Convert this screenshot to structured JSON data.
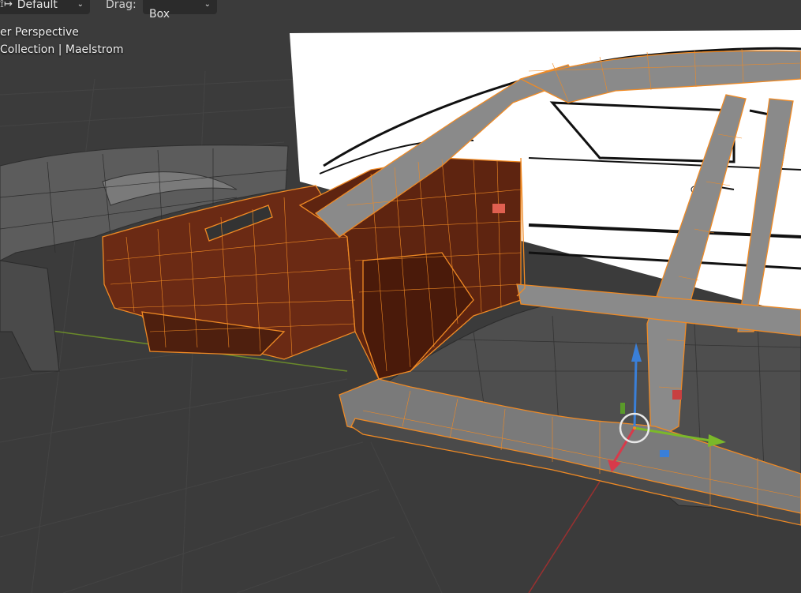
{
  "header": {
    "transform_orientation": {
      "icon": "transform-pivot-icon",
      "value": "Default"
    },
    "drag_label": "Drag:",
    "drag_mode": "Select Box"
  },
  "viewport": {
    "view_name": "er Perspective",
    "collection_info": " Collection | Maelstrom"
  },
  "colors": {
    "background": "#3b3b3b",
    "selected_wire": "#f08a24",
    "mesh_body": "#6b2a14",
    "x_axis": "#b83a3a",
    "y_axis": "#7bb82a",
    "z_axis": "#3a7fd8"
  }
}
